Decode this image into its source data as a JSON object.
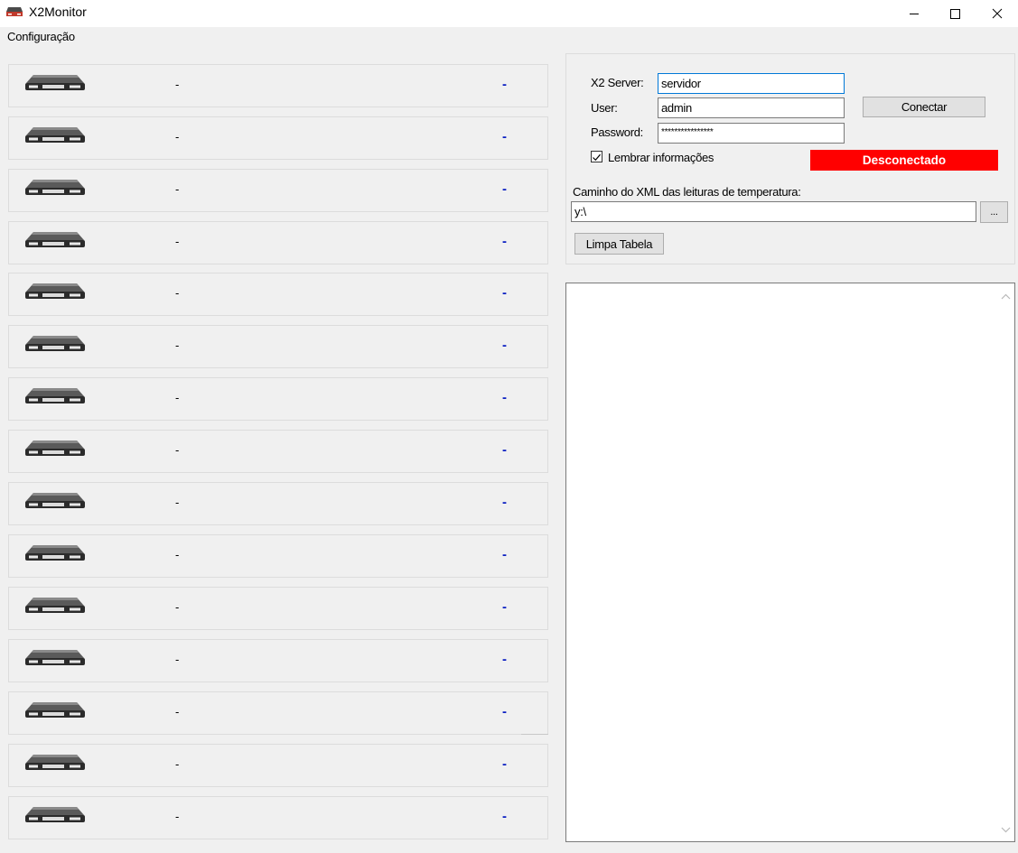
{
  "window": {
    "title": "X2Monitor",
    "icon": "router-icon"
  },
  "menu": {
    "items": [
      "Configuração"
    ]
  },
  "devices": [
    {
      "name": "-",
      "value": "-"
    },
    {
      "name": "-",
      "value": "-"
    },
    {
      "name": "-",
      "value": "-"
    },
    {
      "name": "-",
      "value": "-"
    },
    {
      "name": "-",
      "value": "-"
    },
    {
      "name": "-",
      "value": "-"
    },
    {
      "name": "-",
      "value": "-"
    },
    {
      "name": "-",
      "value": "-"
    },
    {
      "name": "-",
      "value": "-"
    },
    {
      "name": "-",
      "value": "-"
    },
    {
      "name": "-",
      "value": "-"
    },
    {
      "name": "-",
      "value": "-"
    },
    {
      "name": "-",
      "value": "-"
    },
    {
      "name": "-",
      "value": "-"
    },
    {
      "name": "-",
      "value": "-"
    }
  ],
  "connection": {
    "server_label": "X2 Server:",
    "server_value": "servidor",
    "user_label": "User:",
    "user_value": "admin",
    "password_label": "Password:",
    "password_value": "****************",
    "connect_button": "Conectar",
    "remember_label": "Lembrar informações",
    "remember_checked": true,
    "status": "Desconectado",
    "status_color": "#ff0000",
    "xml_path_label": "Caminho do XML das leituras de temperatura:",
    "xml_path_value": "y:\\",
    "browse_button": "...",
    "clear_button": "Limpa Tabela"
  },
  "colors": {
    "temp_value": "#0b1fc2",
    "window_bg": "#f0f0f0"
  }
}
